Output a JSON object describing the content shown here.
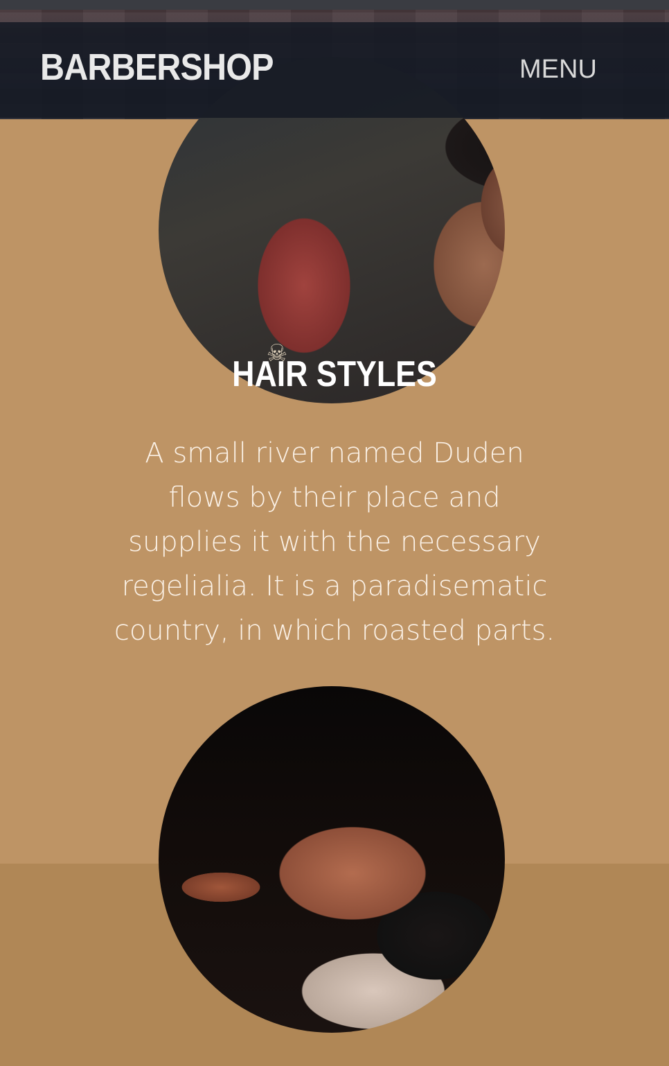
{
  "navbar": {
    "brand": "BARBERSHOP",
    "menu_label": "MENU"
  },
  "section": {
    "title": "HAIR STYLES",
    "description_lines": [
      "A small river named Duden",
      "flows by their place and",
      "supplies it with the necessary",
      "regelialia. It is a paradisematic",
      "country, in which roasted parts."
    ]
  },
  "icons": {
    "skull_emblem": "skull-and-crossbones-icon"
  },
  "colors": {
    "section_bg": "#be9465",
    "lower_bg": "#b08756",
    "navbar_bg": "#161a24",
    "title_text": "#ffffff"
  }
}
